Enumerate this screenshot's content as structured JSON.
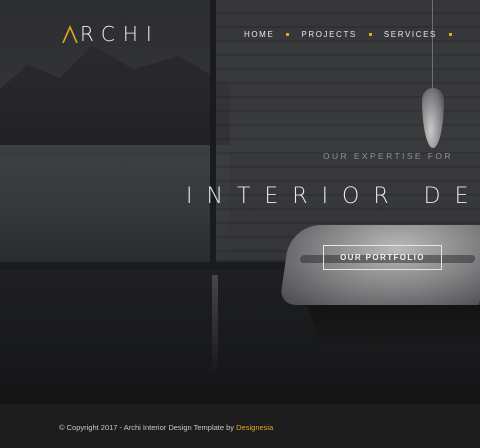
{
  "brand": {
    "logo_text": "RCHI",
    "logo_mark_color": "#e0a820"
  },
  "nav": {
    "items": [
      {
        "label": "HOME"
      },
      {
        "label": "PROJECTS"
      },
      {
        "label": "SERVICES"
      }
    ],
    "separator_color": "#e0a820"
  },
  "hero": {
    "eyebrow": "OUR EXPERTISE FOR",
    "headline": "INTERIOR DES",
    "cta_label": "OUR PORTFOLIO"
  },
  "footer": {
    "copyright_prefix": "© Copyright 2017 - Archi Interior Design Template by ",
    "credit_link": "Designesia",
    "accent_color": "#e0a820"
  }
}
